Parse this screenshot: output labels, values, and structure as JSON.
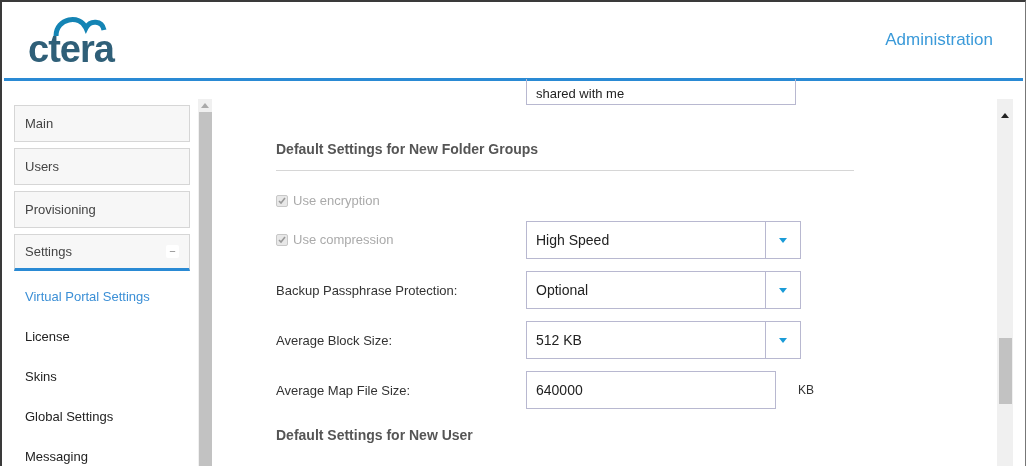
{
  "header": {
    "logo": "ctera",
    "title": "Administration"
  },
  "sidebar": {
    "items": [
      {
        "label": "Main",
        "expanded": false
      },
      {
        "label": "Users",
        "expanded": false
      },
      {
        "label": "Provisioning",
        "expanded": false
      },
      {
        "label": "Settings",
        "expanded": true,
        "toggle": "−",
        "children": [
          {
            "label": "Virtual Portal Settings",
            "selected": true
          },
          {
            "label": "License",
            "selected": false
          },
          {
            "label": "Skins",
            "selected": false
          },
          {
            "label": "Global Settings",
            "selected": false
          },
          {
            "label": "Messaging",
            "selected": false
          }
        ]
      }
    ]
  },
  "content": {
    "top_field": {
      "value": "shared with me"
    },
    "section": {
      "title": "Default Settings for New Folder Groups"
    },
    "rows": [
      {
        "kind": "checkbox",
        "label": "Use encryption",
        "checked": true,
        "disabled": true
      },
      {
        "kind": "checkbox",
        "label": "Use compression",
        "checked": true,
        "disabled": true,
        "select": "High Speed"
      },
      {
        "kind": "select",
        "label": "Backup Passphrase Protection:",
        "value": "Optional"
      },
      {
        "kind": "select",
        "label": "Average Block Size:",
        "value": "512 KB"
      },
      {
        "kind": "text",
        "label": "Average Map File Size:",
        "value": "640000",
        "unit": "KB"
      }
    ],
    "next_section": {
      "title": "Default Settings for New User"
    }
  }
}
